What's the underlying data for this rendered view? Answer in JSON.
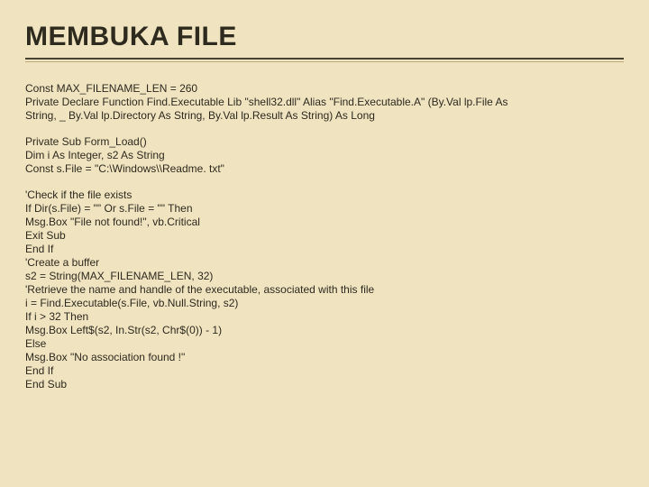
{
  "title": "MEMBUKA FILE",
  "code": {
    "block1": "Const MAX_FILENAME_LEN = 260\nPrivate Declare Function Find.Executable Lib \"shell32.dll\" Alias \"Find.Executable.A\" (By.Val lp.File As\nString, _ By.Val lp.Directory As String, By.Val lp.Result As String) As Long",
    "block2": "Private Sub Form_Load()\nDim i As Integer, s2 As String\nConst s.File = \"C:\\Windows\\\\Readme. txt\"",
    "block3": "'Check if the file exists\nIf Dir(s.File) = \"\" Or s.File = \"\" Then\nMsg.Box \"File not found!\", vb.Critical\nExit Sub\nEnd If\n'Create a buffer\ns2 = String(MAX_FILENAME_LEN, 32)\n'Retrieve the name and handle of the executable, associated with this file\ni = Find.Executable(s.File, vb.Null.String, s2)\nIf i > 32 Then\nMsg.Box Left$(s2, In.Str(s2, Chr$(0)) - 1)\nElse\nMsg.Box \"No association found !\"\nEnd If\nEnd Sub"
  }
}
